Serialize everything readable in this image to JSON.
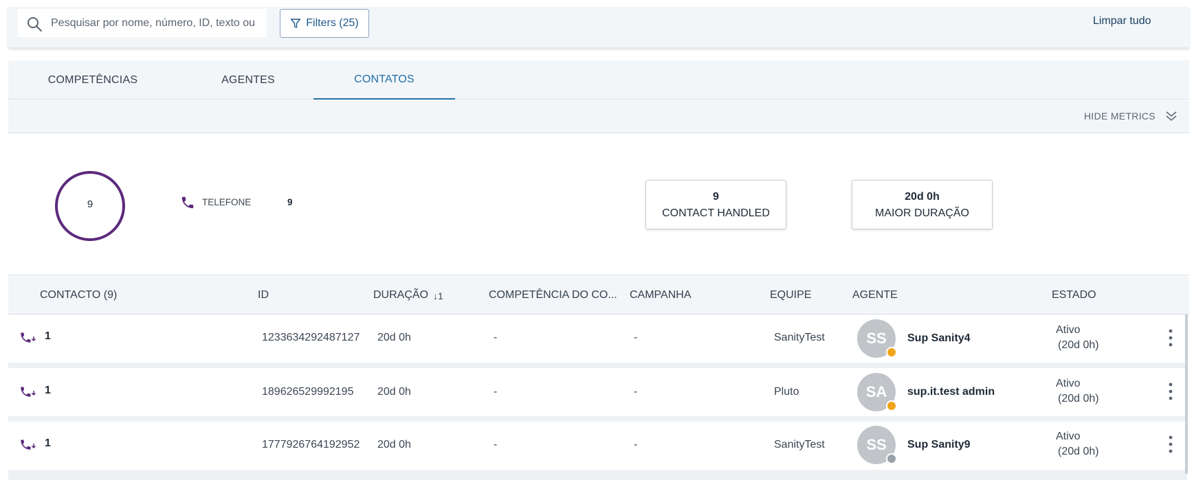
{
  "search": {
    "placeholder": "Pesquisar por nome, número, ID, texto ou"
  },
  "filters": {
    "label": "Filters (25)"
  },
  "clear_all": "Limpar tudo",
  "tabs": [
    {
      "label": "COMPETÊNCIAS",
      "active": false
    },
    {
      "label": "AGENTES",
      "active": false
    },
    {
      "label": "CONTATOS",
      "active": true
    }
  ],
  "metrics": {
    "toggle_label": "HIDE METRICS",
    "donut_total": "9",
    "legend": {
      "label": "TELEFONE",
      "value": "9"
    },
    "cards": [
      {
        "value": "9",
        "label": "CONTACT HANDLED"
      },
      {
        "value": "20d 0h",
        "label": "MAIOR DURAÇÃO"
      }
    ]
  },
  "table": {
    "columns": {
      "contact": "CONTACTO (9)",
      "id": "ID",
      "duration": "DURAÇÃO",
      "duration_sort": "↓1",
      "skill": "COMPETÊNCIA DO CO...",
      "campaign": "CAMPANHA",
      "team": "EQUIPE",
      "agent": "AGENTE",
      "state": "ESTADO"
    },
    "rows": [
      {
        "count": "1",
        "id": "1233634292487127",
        "duration": "20d 0h",
        "skill": "-",
        "campaign": "-",
        "team": "SanityTest",
        "agent_initials": "SS",
        "agent_name": "Sup Sanity4",
        "agent_status": "orange",
        "state": "Ativo",
        "state_duration": "(20d 0h)"
      },
      {
        "count": "1",
        "id": "189626529992195",
        "duration": "20d 0h",
        "skill": "-",
        "campaign": "-",
        "team": "Pluto",
        "agent_initials": "SA",
        "agent_name": "sup.it.test admin",
        "agent_status": "orange",
        "state": "Ativo",
        "state_duration": "(20d 0h)"
      },
      {
        "count": "1",
        "id": "1777926764192952",
        "duration": "20d 0h",
        "skill": "-",
        "campaign": "-",
        "team": "SanityTest",
        "agent_initials": "SS",
        "agent_name": "Sup Sanity9",
        "agent_status": "grey",
        "state": "Ativo",
        "state_duration": "(20d 0h)"
      }
    ]
  },
  "colors": {
    "accent": "#1f6ea8",
    "phone": "#5b2a7c",
    "donut": "#5b2a7c",
    "status_orange": "#f0a417"
  }
}
